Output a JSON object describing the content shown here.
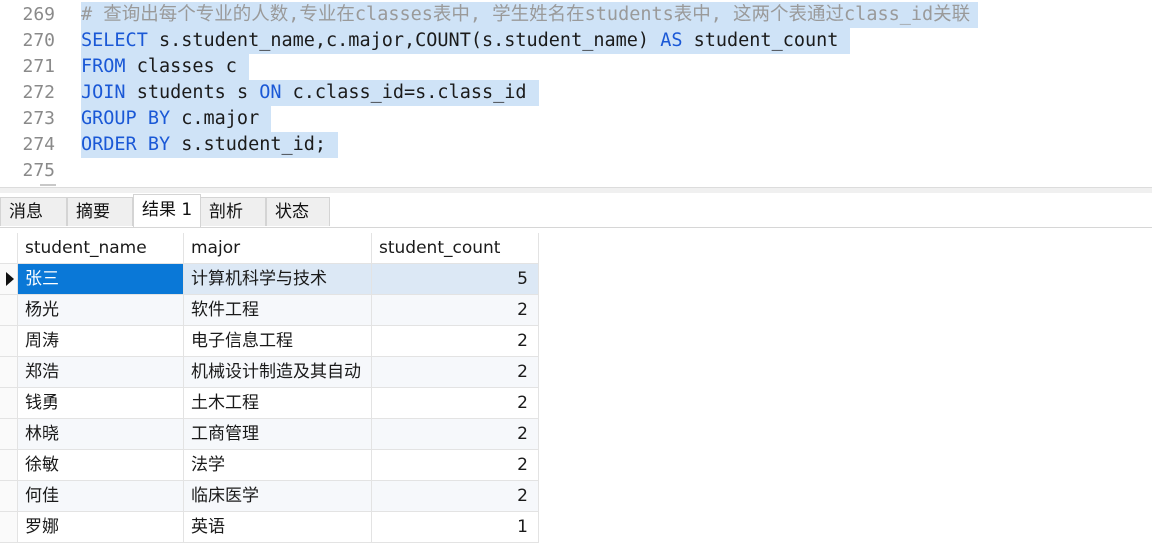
{
  "editor": {
    "lines": [
      {
        "number": "269",
        "kind": "comment",
        "text": "# 查询出每个专业的人数,专业在classes表中, 学生姓名在students表中, 这两个表通过class_id关联"
      },
      {
        "number": "270",
        "kind": "code",
        "parts": [
          "SELECT",
          " s.student_name,c.major,COUNT(s.student_name) ",
          "AS",
          " student_count"
        ]
      },
      {
        "number": "271",
        "kind": "code",
        "parts": [
          "FROM",
          " classes c"
        ]
      },
      {
        "number": "272",
        "kind": "code",
        "parts": [
          "JOIN",
          " students s ",
          "ON",
          " c.class_id=s.class_id"
        ]
      },
      {
        "number": "273",
        "kind": "code",
        "parts": [
          "GROUP BY",
          " c.major"
        ]
      },
      {
        "number": "274",
        "kind": "code",
        "parts": [
          "ORDER BY",
          " s.student_id;"
        ]
      },
      {
        "number": "275",
        "kind": "blank"
      }
    ]
  },
  "tabs": [
    {
      "label": "消息",
      "active": false
    },
    {
      "label": "摘要",
      "active": false
    },
    {
      "label": "结果 1",
      "active": true
    },
    {
      "label": "剖析",
      "active": false
    },
    {
      "label": "状态",
      "active": false
    }
  ],
  "grid": {
    "columns": [
      "student_name",
      "major",
      "student_count"
    ],
    "rows": [
      [
        "张三",
        "计算机科学与技术",
        "5"
      ],
      [
        "杨光",
        "软件工程",
        "2"
      ],
      [
        "周涛",
        "电子信息工程",
        "2"
      ],
      [
        "郑浩",
        "机械设计制造及其自动",
        "2"
      ],
      [
        "钱勇",
        "土木工程",
        "2"
      ],
      [
        "林晓",
        "工商管理",
        "2"
      ],
      [
        "徐敏",
        "法学",
        "2"
      ],
      [
        "何佳",
        "临床医学",
        "2"
      ],
      [
        "罗娜",
        "英语",
        "1"
      ]
    ],
    "current_row": 0
  },
  "colors": {
    "keyword": "#1a58d6",
    "selection": "#cfe3f7",
    "current_cell": "#0a78d7"
  }
}
